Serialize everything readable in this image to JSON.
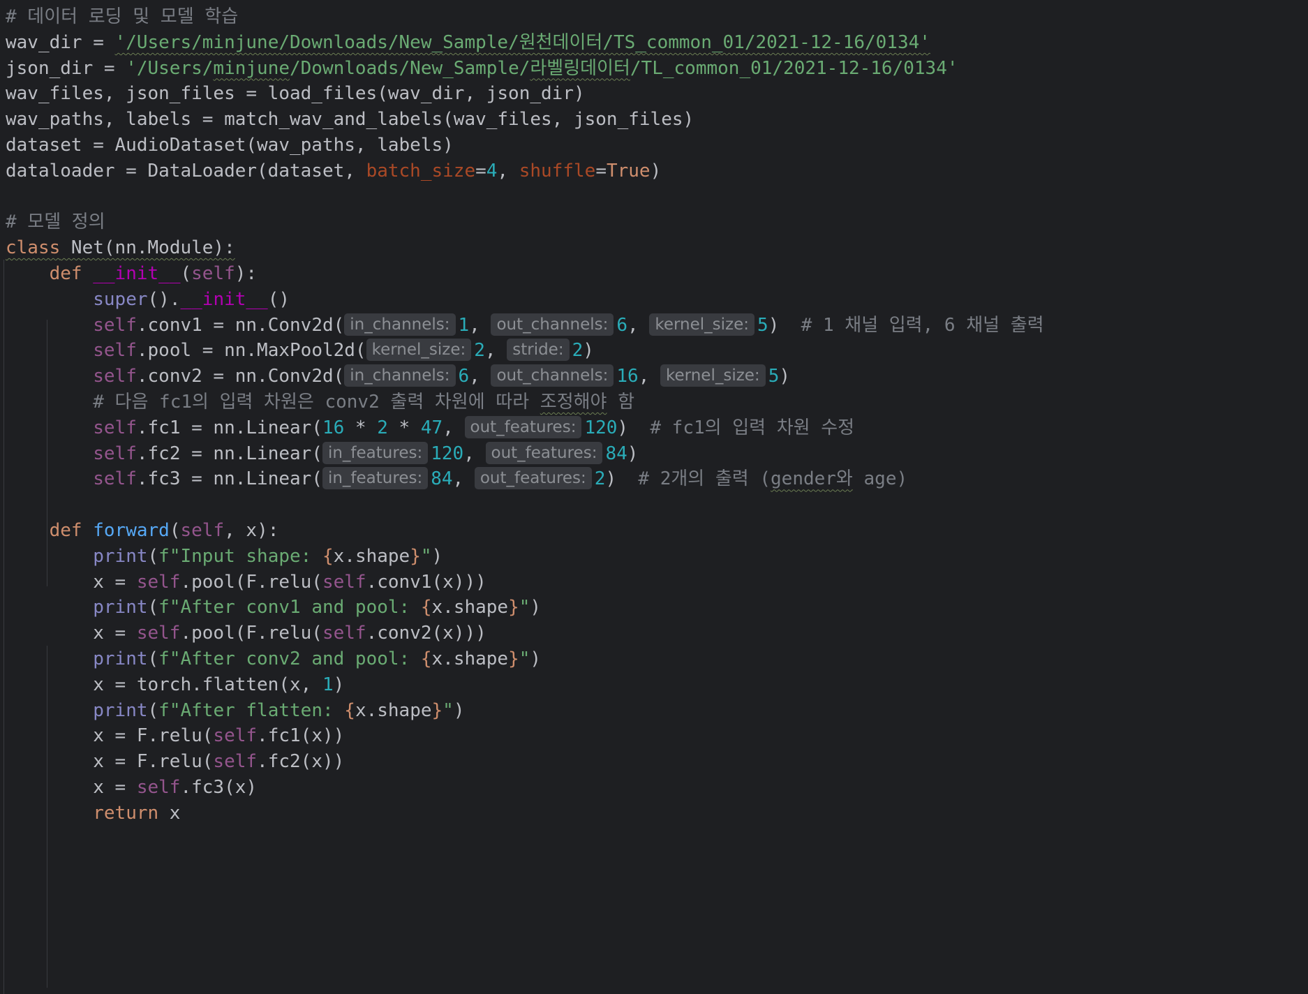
{
  "lines": [
    [
      {
        "t": "# 데이터 로딩 및 모델 학습",
        "c": "comment"
      }
    ],
    [
      {
        "t": "wav_dir = ",
        "c": "plain"
      },
      {
        "t": "'/Users/minjune/Downloads/New_Sample/원천데이터/TS_common_01/2021-12-16/0134'",
        "c": "string",
        "w": true
      }
    ],
    [
      {
        "t": "json_dir = ",
        "c": "plain"
      },
      {
        "t": "'/Users/",
        "c": "string"
      },
      {
        "t": "minjune",
        "c": "string",
        "w": true
      },
      {
        "t": "/Downloads/New_Sample/",
        "c": "string"
      },
      {
        "t": "라벨링데이터",
        "c": "string",
        "w": true
      },
      {
        "t": "/TL_common_01/2021-12-16/0134'",
        "c": "string"
      }
    ],
    [
      {
        "t": "wav_files, json_files = load_files(wav_dir, json_dir)",
        "c": "plain"
      }
    ],
    [
      {
        "t": "wav_paths, labels = match_wav_and_labels(wav_files, json_files)",
        "c": "plain"
      }
    ],
    [
      {
        "t": "dataset = AudioDataset(wav_paths, labels)",
        "c": "plain"
      }
    ],
    [
      {
        "t": "dataloader = DataLoader(dataset, ",
        "c": "plain"
      },
      {
        "t": "batch_size",
        "c": "kwarg"
      },
      {
        "t": "=",
        "c": "plain"
      },
      {
        "t": "4",
        "c": "number"
      },
      {
        "t": ", ",
        "c": "plain"
      },
      {
        "t": "shuffle",
        "c": "kwarg"
      },
      {
        "t": "=",
        "c": "plain"
      },
      {
        "t": "True",
        "c": "keyword"
      },
      {
        "t": ")",
        "c": "plain"
      }
    ],
    [],
    [
      {
        "t": "# 모델 정의",
        "c": "comment"
      }
    ],
    [
      {
        "t": "class",
        "c": "keyword",
        "w": true
      },
      {
        "t": " Net(nn.Module):",
        "c": "plain",
        "w": true
      }
    ],
    [
      {
        "t": "    ",
        "c": "plain"
      },
      {
        "t": "def",
        "c": "keyword"
      },
      {
        "t": " ",
        "c": "plain"
      },
      {
        "t": "__init__",
        "c": "magic"
      },
      {
        "t": "(",
        "c": "plain"
      },
      {
        "t": "self",
        "c": "self"
      },
      {
        "t": "):",
        "c": "plain"
      }
    ],
    [
      {
        "t": "        ",
        "c": "plain"
      },
      {
        "t": "super",
        "c": "builtin"
      },
      {
        "t": "().",
        "c": "plain"
      },
      {
        "t": "__init__",
        "c": "magic"
      },
      {
        "t": "()",
        "c": "plain"
      }
    ],
    [
      {
        "t": "        ",
        "c": "plain"
      },
      {
        "t": "self",
        "c": "self"
      },
      {
        "t": ".conv1 = nn.Conv2d(",
        "c": "plain"
      },
      {
        "h": "in_channels:"
      },
      {
        "t": "1",
        "c": "number"
      },
      {
        "t": ", ",
        "c": "plain"
      },
      {
        "h": "out_channels:"
      },
      {
        "t": "6",
        "c": "number"
      },
      {
        "t": ", ",
        "c": "plain"
      },
      {
        "h": "kernel_size:"
      },
      {
        "t": "5",
        "c": "number"
      },
      {
        "t": ")  ",
        "c": "plain"
      },
      {
        "t": "# 1 채널 입력, 6 채널 출력",
        "c": "comment"
      }
    ],
    [
      {
        "t": "        ",
        "c": "plain"
      },
      {
        "t": "self",
        "c": "self"
      },
      {
        "t": ".pool = nn.MaxPool2d(",
        "c": "plain"
      },
      {
        "h": "kernel_size:"
      },
      {
        "t": "2",
        "c": "number"
      },
      {
        "t": ", ",
        "c": "plain"
      },
      {
        "h": "stride:"
      },
      {
        "t": "2",
        "c": "number"
      },
      {
        "t": ")",
        "c": "plain"
      }
    ],
    [
      {
        "t": "        ",
        "c": "plain"
      },
      {
        "t": "self",
        "c": "self"
      },
      {
        "t": ".conv2 = nn.Conv2d(",
        "c": "plain"
      },
      {
        "h": "in_channels:"
      },
      {
        "t": "6",
        "c": "number"
      },
      {
        "t": ", ",
        "c": "plain"
      },
      {
        "h": "out_channels:"
      },
      {
        "t": "16",
        "c": "number"
      },
      {
        "t": ", ",
        "c": "plain"
      },
      {
        "h": "kernel_size:"
      },
      {
        "t": "5",
        "c": "number"
      },
      {
        "t": ")",
        "c": "plain"
      }
    ],
    [
      {
        "t": "        ",
        "c": "plain"
      },
      {
        "t": "# 다음 fc1의 입력 차원은 conv2 출력 차원에 따라 ",
        "c": "comment"
      },
      {
        "t": "조정해야",
        "c": "comment",
        "w": true
      },
      {
        "t": " 함",
        "c": "comment"
      }
    ],
    [
      {
        "t": "        ",
        "c": "plain"
      },
      {
        "t": "self",
        "c": "self"
      },
      {
        "t": ".fc1 = nn.Linear(",
        "c": "plain"
      },
      {
        "t": "16",
        "c": "number"
      },
      {
        "t": " * ",
        "c": "plain"
      },
      {
        "t": "2",
        "c": "number"
      },
      {
        "t": " * ",
        "c": "plain"
      },
      {
        "t": "47",
        "c": "number"
      },
      {
        "t": ", ",
        "c": "plain"
      },
      {
        "h": "out_features:"
      },
      {
        "t": "120",
        "c": "number"
      },
      {
        "t": ")  ",
        "c": "plain"
      },
      {
        "t": "# fc1의 입력 차원 수정",
        "c": "comment"
      }
    ],
    [
      {
        "t": "        ",
        "c": "plain"
      },
      {
        "t": "self",
        "c": "self"
      },
      {
        "t": ".fc2 = nn.Linear(",
        "c": "plain"
      },
      {
        "h": "in_features:"
      },
      {
        "t": "120",
        "c": "number"
      },
      {
        "t": ", ",
        "c": "plain"
      },
      {
        "h": "out_features:"
      },
      {
        "t": "84",
        "c": "number"
      },
      {
        "t": ")",
        "c": "plain"
      }
    ],
    [
      {
        "t": "        ",
        "c": "plain"
      },
      {
        "t": "self",
        "c": "self"
      },
      {
        "t": ".fc3 = nn.Linear(",
        "c": "plain"
      },
      {
        "h": "in_features:"
      },
      {
        "t": "84",
        "c": "number"
      },
      {
        "t": ", ",
        "c": "plain"
      },
      {
        "h": "out_features:"
      },
      {
        "t": "2",
        "c": "number"
      },
      {
        "t": ")  ",
        "c": "plain"
      },
      {
        "t": "# 2개의 출력 (",
        "c": "comment"
      },
      {
        "t": "gender와",
        "c": "comment",
        "w": true
      },
      {
        "t": " age)",
        "c": "comment"
      }
    ],
    [],
    [
      {
        "t": "    ",
        "c": "plain"
      },
      {
        "t": "def",
        "c": "keyword"
      },
      {
        "t": " ",
        "c": "plain"
      },
      {
        "t": "forward",
        "c": "fn"
      },
      {
        "t": "(",
        "c": "plain"
      },
      {
        "t": "self",
        "c": "self"
      },
      {
        "t": ", x):",
        "c": "plain"
      }
    ],
    [
      {
        "t": "        ",
        "c": "plain"
      },
      {
        "t": "print",
        "c": "builtin"
      },
      {
        "t": "(",
        "c": "plain"
      },
      {
        "t": "f\"Input shape: ",
        "c": "string"
      },
      {
        "t": "{",
        "c": "brace"
      },
      {
        "t": "x.shape",
        "c": "plain"
      },
      {
        "t": "}",
        "c": "brace"
      },
      {
        "t": "\"",
        "c": "string"
      },
      {
        "t": ")",
        "c": "plain"
      }
    ],
    [
      {
        "t": "        x = ",
        "c": "plain"
      },
      {
        "t": "self",
        "c": "self"
      },
      {
        "t": ".pool(F.relu(",
        "c": "plain"
      },
      {
        "t": "self",
        "c": "self"
      },
      {
        "t": ".conv1(x)))",
        "c": "plain"
      }
    ],
    [
      {
        "t": "        ",
        "c": "plain"
      },
      {
        "t": "print",
        "c": "builtin"
      },
      {
        "t": "(",
        "c": "plain"
      },
      {
        "t": "f\"After conv1 and pool: ",
        "c": "string"
      },
      {
        "t": "{",
        "c": "brace"
      },
      {
        "t": "x.shape",
        "c": "plain"
      },
      {
        "t": "}",
        "c": "brace"
      },
      {
        "t": "\"",
        "c": "string"
      },
      {
        "t": ")",
        "c": "plain"
      }
    ],
    [
      {
        "t": "        x = ",
        "c": "plain"
      },
      {
        "t": "self",
        "c": "self"
      },
      {
        "t": ".pool(F.relu(",
        "c": "plain"
      },
      {
        "t": "self",
        "c": "self"
      },
      {
        "t": ".conv2(x)))",
        "c": "plain"
      }
    ],
    [
      {
        "t": "        ",
        "c": "plain"
      },
      {
        "t": "print",
        "c": "builtin"
      },
      {
        "t": "(",
        "c": "plain"
      },
      {
        "t": "f\"After conv2 and pool: ",
        "c": "string"
      },
      {
        "t": "{",
        "c": "brace"
      },
      {
        "t": "x.shape",
        "c": "plain"
      },
      {
        "t": "}",
        "c": "brace"
      },
      {
        "t": "\"",
        "c": "string"
      },
      {
        "t": ")",
        "c": "plain"
      }
    ],
    [
      {
        "t": "        x = torch.flatten(x, ",
        "c": "plain"
      },
      {
        "t": "1",
        "c": "number"
      },
      {
        "t": ")",
        "c": "plain"
      }
    ],
    [
      {
        "t": "        ",
        "c": "plain"
      },
      {
        "t": "print",
        "c": "builtin"
      },
      {
        "t": "(",
        "c": "plain"
      },
      {
        "t": "f\"After flatten: ",
        "c": "string"
      },
      {
        "t": "{",
        "c": "brace"
      },
      {
        "t": "x.shape",
        "c": "plain"
      },
      {
        "t": "}",
        "c": "brace"
      },
      {
        "t": "\"",
        "c": "string"
      },
      {
        "t": ")",
        "c": "plain"
      }
    ],
    [
      {
        "t": "        x = F.relu(",
        "c": "plain"
      },
      {
        "t": "self",
        "c": "self"
      },
      {
        "t": ".fc1(x))",
        "c": "plain"
      }
    ],
    [
      {
        "t": "        x = F.relu(",
        "c": "plain"
      },
      {
        "t": "self",
        "c": "self"
      },
      {
        "t": ".fc2(x))",
        "c": "plain"
      }
    ],
    [
      {
        "t": "        x = ",
        "c": "plain"
      },
      {
        "t": "self",
        "c": "self"
      },
      {
        "t": ".fc3(x)",
        "c": "plain"
      }
    ],
    [
      {
        "t": "        ",
        "c": "plain"
      },
      {
        "t": "return",
        "c": "keyword"
      },
      {
        "t": " x",
        "c": "plain"
      }
    ]
  ]
}
